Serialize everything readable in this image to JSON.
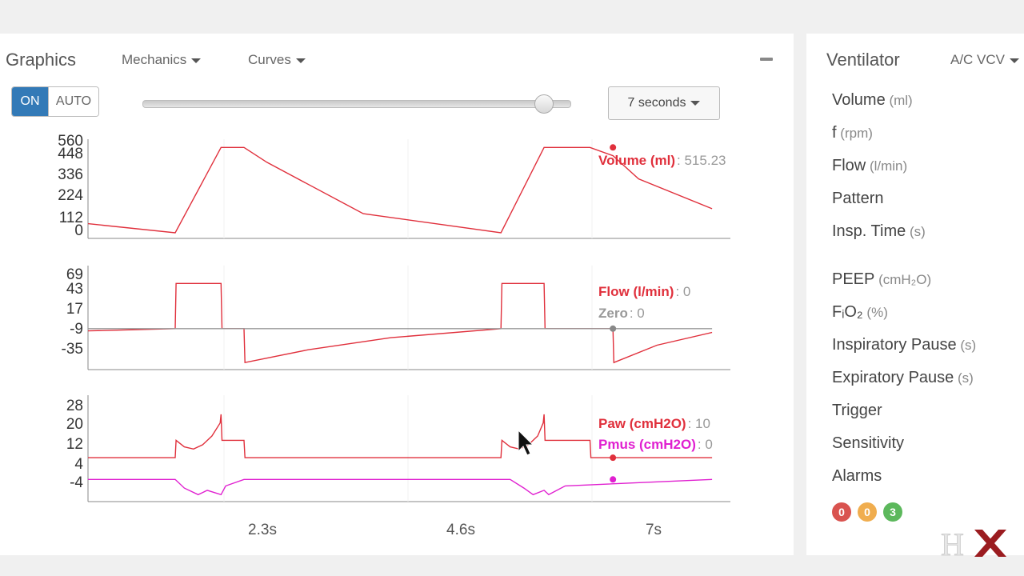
{
  "left": {
    "title": "Graphics",
    "menu_mechanics": "Mechanics",
    "menu_curves": "Curves",
    "toggle_on": "ON",
    "toggle_auto": "AUTO",
    "window_slider_value_fraction": 0.94,
    "window_select": "7 seconds"
  },
  "right": {
    "title": "Ventilator",
    "mode": "A/C VCV",
    "items": [
      {
        "label": "Volume",
        "unit": "(ml)"
      },
      {
        "label": "f",
        "unit": "(rpm)"
      },
      {
        "label": "Flow",
        "unit": "(l/min)"
      },
      {
        "label": "Pattern",
        "unit": ""
      },
      {
        "label": "Insp. Time",
        "unit": "(s)"
      },
      {
        "label": "PEEP",
        "unit": "(cmH₂O)"
      },
      {
        "label": "FᵢO₂",
        "unit": "(%)"
      },
      {
        "label": "Inspiratory Pause",
        "unit": "(s)"
      },
      {
        "label": "Expiratory Pause",
        "unit": "(s)"
      },
      {
        "label": "Trigger",
        "unit": ""
      },
      {
        "label": "Sensitivity",
        "unit": ""
      },
      {
        "label": "Alarms",
        "unit": ""
      }
    ],
    "alarms": [
      {
        "count": "0",
        "color": "#d9534f"
      },
      {
        "count": "0",
        "color": "#f0ad4e"
      },
      {
        "count": "3",
        "color": "#5cb85c"
      }
    ]
  },
  "logo_text": "HX",
  "chart_data": [
    {
      "type": "line",
      "name": "volume",
      "yticks": [
        "560",
        "448",
        "336",
        "224",
        "112",
        "0"
      ],
      "ylim": [
        0,
        560
      ],
      "xlim": [
        0,
        7
      ],
      "series": [
        {
          "name": "Volume (ml)",
          "color": "#e0303c",
          "value_text": "515.23",
          "x": [
            0,
            0.95,
            1.45,
            1.7,
            1.95,
            3.0,
            4.5,
            4.97,
            5.47,
            5.72,
            6.0,
            6.8
          ],
          "y": [
            60,
            5,
            520,
            520,
            430,
            120,
            5,
            520,
            520,
            470,
            330,
            150
          ]
        }
      ],
      "cursor": {
        "x": 5.72,
        "y": 520
      }
    },
    {
      "type": "line",
      "name": "flow",
      "yticks": [
        "69",
        "43",
        "17",
        "-9",
        "-35"
      ],
      "ylim": [
        -48,
        72
      ],
      "xlim": [
        0,
        7
      ],
      "series": [
        {
          "name": "Flow (l/min)",
          "color": "#e0303c",
          "value_text": "0",
          "x": [
            0,
            0.95,
            0.96,
            1.45,
            1.46,
            1.7,
            1.71,
            2.4,
            3.3,
            4.5,
            4.51,
            4.97,
            4.98,
            5.47,
            5.48,
            5.72,
            5.73,
            6.2,
            6.8
          ],
          "y": [
            -3,
            0,
            60,
            60,
            0,
            0,
            -45,
            -28,
            -12,
            0,
            60,
            60,
            0,
            0,
            0,
            0,
            -45,
            -22,
            -5
          ]
        },
        {
          "name": "Zero",
          "color": "#999999",
          "value_text": "0",
          "x": [
            0,
            6.8
          ],
          "y": [
            0,
            0
          ]
        }
      ],
      "cursor": {
        "x": 5.72,
        "y": 0
      }
    },
    {
      "type": "line",
      "name": "pressure",
      "yticks": [
        "28",
        "20",
        "12",
        "4",
        "-4"
      ],
      "ylim": [
        -8,
        34
      ],
      "xlim": [
        0,
        7
      ],
      "series": [
        {
          "name": "Paw (cmH2O)",
          "color": "#e0303c",
          "value_text": "10",
          "x": [
            0,
            0.95,
            0.96,
            1.05,
            1.15,
            1.25,
            1.35,
            1.44,
            1.45,
            1.46,
            1.7,
            1.71,
            4.5,
            4.51,
            4.6,
            4.7,
            4.8,
            4.9,
            4.96,
            4.97,
            4.98,
            5.47,
            5.48,
            6.8
          ],
          "y": [
            10,
            10,
            18,
            15,
            14,
            16,
            20,
            26,
            30,
            18,
            18,
            10,
            10,
            18,
            15,
            14,
            16,
            20,
            26,
            30,
            18,
            18,
            10,
            10
          ]
        },
        {
          "name": "Pmus (cmH2O)",
          "color": "#e020d0",
          "value_text": "0",
          "x": [
            0,
            0.95,
            1.05,
            1.2,
            1.3,
            1.45,
            1.5,
            1.7,
            4.5,
            4.6,
            4.75,
            4.85,
            4.97,
            5.02,
            5.2,
            6.8
          ],
          "y": [
            0,
            0,
            -4,
            -7,
            -5,
            -7,
            -3,
            0,
            0,
            0,
            -4,
            -7,
            -5,
            -7,
            -3,
            0
          ]
        }
      ],
      "cursor": {
        "x": 5.72,
        "y": 10
      },
      "xticks": [
        "2.3s",
        "4.6s",
        "7s"
      ]
    }
  ]
}
